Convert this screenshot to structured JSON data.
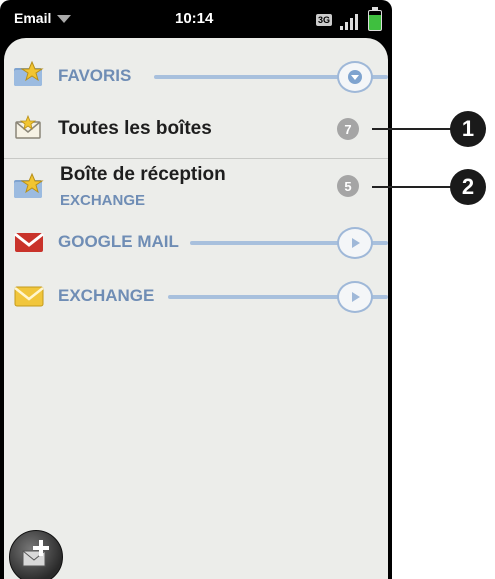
{
  "statusbar": {
    "app_name": "Email",
    "time": "10:14",
    "network": "3G"
  },
  "favorites": {
    "header_label": "FAVORIS",
    "all_inboxes": {
      "label": "Toutes les boîtes",
      "count": "7"
    },
    "inbox": {
      "label": "Boîte de réception",
      "account": "EXCHANGE",
      "count": "5"
    }
  },
  "accounts": [
    {
      "label": "GOOGLE MAIL"
    },
    {
      "label": "EXCHANGE"
    }
  ],
  "callouts": [
    "1",
    "2"
  ],
  "colors": {
    "accent_blue": "#6f8db5",
    "badge_gray": "#a5a5a5",
    "gmail_red": "#c9332b",
    "exchange_yellow": "#f1c63c"
  },
  "icons": {
    "compose": "compose-email-icon",
    "favorites": "star-folder-icon",
    "all_inboxes": "envelope-star-icon",
    "gmail": "gmail-envelope-icon",
    "exchange": "exchange-envelope-icon"
  }
}
